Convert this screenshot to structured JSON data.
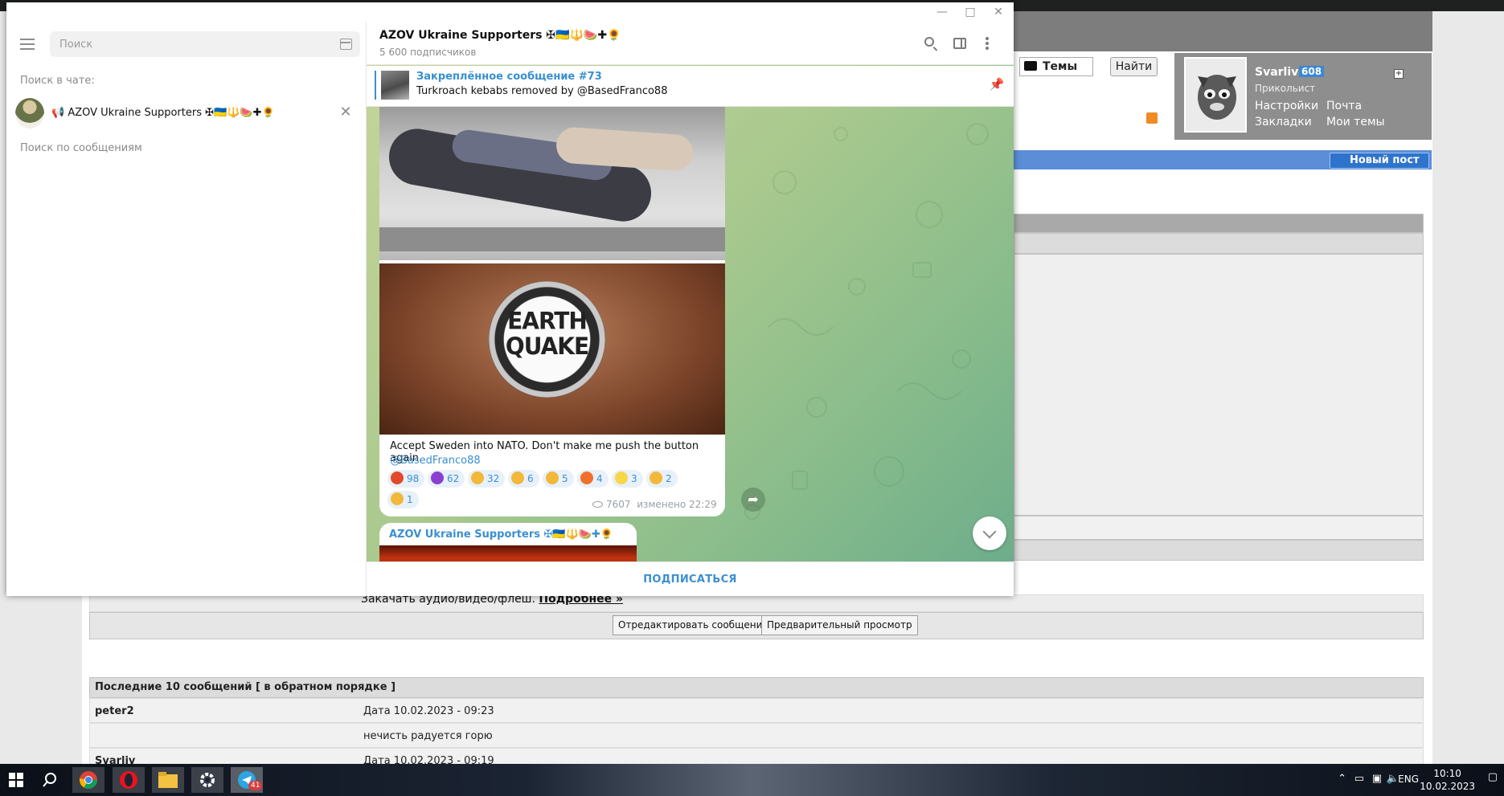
{
  "forum": {
    "themes_label": "Темы",
    "find_button": "Найти",
    "user": {
      "name": "Svarliv",
      "count": "608",
      "rank": "Прикольист",
      "links": [
        "Настройки",
        "Почта",
        "Закладки",
        "Мои темы"
      ]
    },
    "new_post_button": "Новый пост",
    "upload_text": "Закачать аудио/видео/флеш.",
    "upload_more_link": "Подробнее »",
    "edit_button": "Отредактировать сообщение",
    "preview_button": "Предварительный просмотр",
    "last_messages_header": "Последние 10 сообщений [ в обратном порядке ]",
    "last_messages": [
      {
        "author": "peter2",
        "text": "Дата 10.02.2023 - 09:23"
      },
      {
        "author": "",
        "text": "нечисть радуется горю"
      },
      {
        "author": "Svarliv",
        "text": "Дата 10.02.2023 - 09:19"
      }
    ]
  },
  "telegram": {
    "search_placeholder": "Поиск",
    "label_in_chat": "Поиск в чате:",
    "selected_chat": "📢 AZOV Ukraine Supporters ✠🇺🇦🔱🍉✚🌻",
    "label_search_messages": "Поиск по сообщениям",
    "channel_title": "AZOV Ukraine Supporters ✠🇺🇦🔱🍉✚🌻",
    "channel_subscribers": "5 600 подписчиков",
    "pinned": {
      "title": "Закреплённое сообщение #73",
      "text": "Turkroach kebabs removed by @BasedFranco88"
    },
    "message": {
      "earthquake_button_text": "EARTH QUAKE",
      "caption": "Accept Sweden into NATO. Don't make me push the button again.",
      "author_link": "@BasedFranco88",
      "reactions": [
        {
          "emoji": "angry-face",
          "count": "98",
          "color": "#e24a2b"
        },
        {
          "emoji": "smiling-devil",
          "count": "62",
          "color": "#8b3fd1"
        },
        {
          "emoji": "thumbs-down",
          "count": "32",
          "color": "#f2b83a"
        },
        {
          "emoji": "hearts-face",
          "count": "6",
          "color": "#f2b83a"
        },
        {
          "emoji": "thumbs-up",
          "count": "5",
          "color": "#f2b83a"
        },
        {
          "emoji": "fire",
          "count": "4",
          "color": "#f0702a"
        },
        {
          "emoji": "banana",
          "count": "3",
          "color": "#f7d64a"
        },
        {
          "emoji": "grimacing-face",
          "count": "2",
          "color": "#f2b83a"
        },
        {
          "emoji": "pleading-face",
          "count": "1",
          "color": "#f2b83a"
        }
      ],
      "views": "7607",
      "edited": "изменено 22:29"
    },
    "next_message_author": "AZOV Ukraine Supporters ✠🇺🇦🔱🍉✚🌻",
    "subscribe_button": "ПОДПИСАТЬСЯ"
  },
  "taskbar": {
    "apps": [
      "start-icon",
      "search-icon",
      "chrome-icon",
      "opera-icon",
      "file-explorer-icon",
      "settings-icon",
      "telegram-icon"
    ],
    "telegram_badge": "41",
    "language": "ENG",
    "time": "10:10",
    "date": "10.02.2023"
  }
}
